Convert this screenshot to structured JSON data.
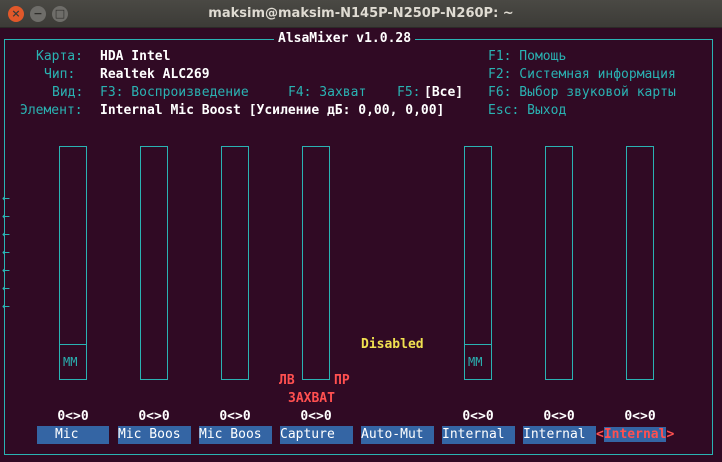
{
  "window": {
    "title": "maksim@maksim-N145P-N250P-N260P: ~",
    "close_glyph": "×",
    "min_glyph": "−",
    "max_glyph": "□"
  },
  "header": {
    "app_title": "AlsaMixer v1.0.28",
    "card_label": "Карта:",
    "card_value": "HDA Intel",
    "chip_label": "Чип:",
    "chip_value": "Realtek ALC269",
    "view_label": "Вид:",
    "view_f3": "F3: Воспроизведение",
    "view_f4": "F4: Захват",
    "view_f5": "F5:",
    "view_f5_value": "[Все]",
    "element_label": "Элемент:",
    "element_value": "Internal Mic Boost [Усиление дБ: 0,00, 0,00]",
    "help_f1": "F1: Помощь",
    "help_f2": "F2: Системная информация",
    "help_f6": "F6: Выбор звуковой карты",
    "help_esc": "Esc: Выход"
  },
  "left_arrow": "←",
  "status": {
    "disabled": "Disabled",
    "left": "ЛВ",
    "right": "ПР",
    "capture": "ЗАХВАТ"
  },
  "mm_label": "MM",
  "controls": [
    {
      "name": "Mic",
      "value": "0<>0"
    },
    {
      "name": "Mic Boos",
      "value": "0<>0"
    },
    {
      "name": "Mic Boos",
      "value": "0<>0"
    },
    {
      "name": "Capture",
      "value": "0<>0"
    },
    {
      "name": "Auto-Mut",
      "value": ""
    },
    {
      "name": "Internal",
      "value": "0<>0"
    },
    {
      "name": "Internal",
      "value": "0<>0"
    },
    {
      "name": "Internal",
      "value": "0<>0",
      "open": "<",
      "close": ">"
    }
  ],
  "colors": {
    "background": "#300a24",
    "border": "#2ab3b3",
    "selection": "#3465a4",
    "highlight": "#f0e050",
    "alert": "#ff5050"
  }
}
